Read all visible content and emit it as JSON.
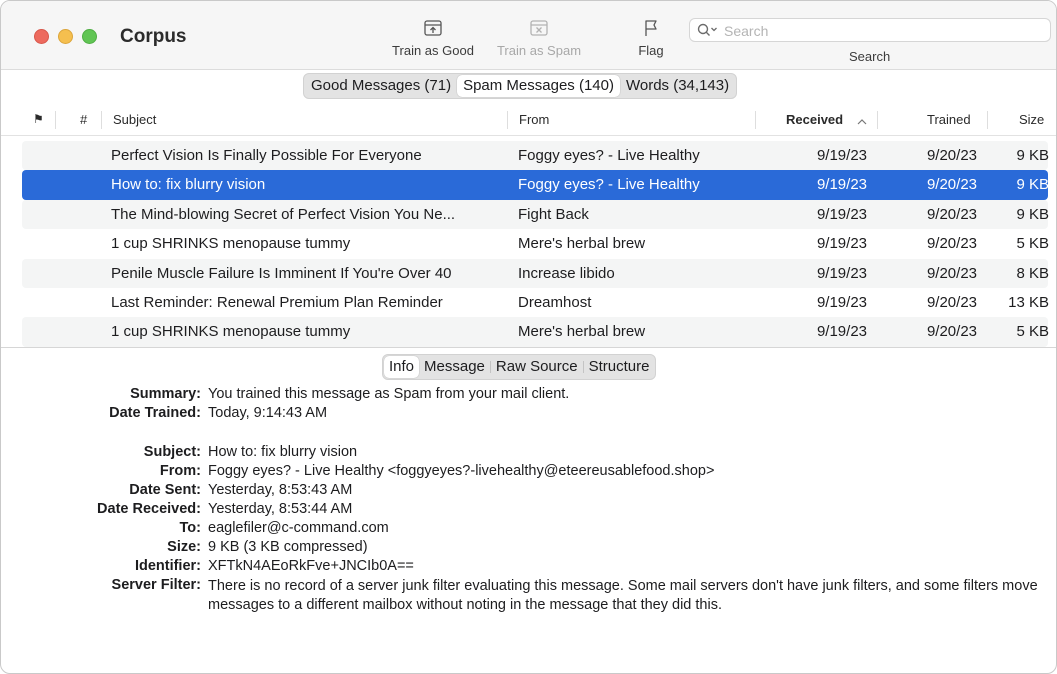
{
  "window": {
    "title": "Corpus"
  },
  "toolbar": {
    "train_good": "Train as Good",
    "train_spam": "Train as Spam",
    "flag": "Flag",
    "search_placeholder": "Search",
    "search_label": "Search"
  },
  "tabs": [
    {
      "label": "Good Messages (71)",
      "active": false
    },
    {
      "label": "Spam Messages (140)",
      "active": true
    },
    {
      "label": "Words (34,143)",
      "active": false
    }
  ],
  "table": {
    "columns": {
      "flag": "⚑",
      "number": "#",
      "subject": "Subject",
      "from": "From",
      "received": "Received",
      "trained": "Trained",
      "size": "Size"
    },
    "rows": [
      {
        "subject": "Perfect Vision Is Finally Possible For Everyone",
        "from": "Foggy eyes? - Live Healthy",
        "received": "9/19/23",
        "trained": "9/20/23",
        "size": "9 KB",
        "selected": false
      },
      {
        "subject": "How to: fix blurry vision",
        "from": "Foggy eyes? - Live Healthy",
        "received": "9/19/23",
        "trained": "9/20/23",
        "size": "9 KB",
        "selected": true
      },
      {
        "subject": "The Mind-blowing Secret of Perfect Vision You Ne...",
        "from": "Fight Back",
        "received": "9/19/23",
        "trained": "9/20/23",
        "size": "9 KB",
        "selected": false
      },
      {
        "subject": "1 cup SHRINKS menopause tummy",
        "from": "Mere's herbal brew",
        "received": "9/19/23",
        "trained": "9/20/23",
        "size": "5 KB",
        "selected": false
      },
      {
        "subject": "Penile Muscle Failure Is Imminent If You're Over 40",
        "from": "Increase libido",
        "received": "9/19/23",
        "trained": "9/20/23",
        "size": "8 KB",
        "selected": false
      },
      {
        "subject": "Last Reminder: Renewal Premium Plan Reminder",
        "from": "Dreamhost",
        "received": "9/19/23",
        "trained": "9/20/23",
        "size": "13 KB",
        "selected": false
      },
      {
        "subject": "1 cup SHRINKS menopause tummy",
        "from": "Mere's herbal brew",
        "received": "9/19/23",
        "trained": "9/20/23",
        "size": "5 KB",
        "selected": false
      }
    ]
  },
  "detail_tabs": [
    {
      "label": "Info",
      "active": true
    },
    {
      "label": "Message",
      "active": false
    },
    {
      "label": "Raw Source",
      "active": false
    },
    {
      "label": "Structure",
      "active": false
    }
  ],
  "info": {
    "summary_label": "Summary:",
    "summary": "You trained this message as Spam from your mail client.",
    "date_trained_label": "Date Trained:",
    "date_trained": "Today, 9:14:43 AM",
    "subject_label": "Subject:",
    "subject": "How to: fix blurry vision",
    "from_label": "From:",
    "from": "Foggy eyes? - Live Healthy <foggyeyes?-livehealthy@eteereusablefood.shop>",
    "date_sent_label": "Date Sent:",
    "date_sent": "Yesterday, 8:53:43 AM",
    "date_received_label": "Date Received:",
    "date_received": "Yesterday, 8:53:44 AM",
    "to_label": "To:",
    "to": "eaglefiler@c-command.com",
    "size_label": "Size:",
    "size": "9 KB (3 KB compressed)",
    "identifier_label": "Identifier:",
    "identifier": "XFTkN4AEoRkFve+JNCIb0A==",
    "server_filter_label": "Server Filter:",
    "server_filter": "There is no record of a server junk filter evaluating this message. Some mail servers don't have junk filters, and some filters move messages to a different mailbox without noting in the message that they did this."
  },
  "colors": {
    "selection": "#2a6ad8",
    "close": "#ed6a5e",
    "minimize": "#f5bf4f",
    "zoom": "#61c554"
  }
}
